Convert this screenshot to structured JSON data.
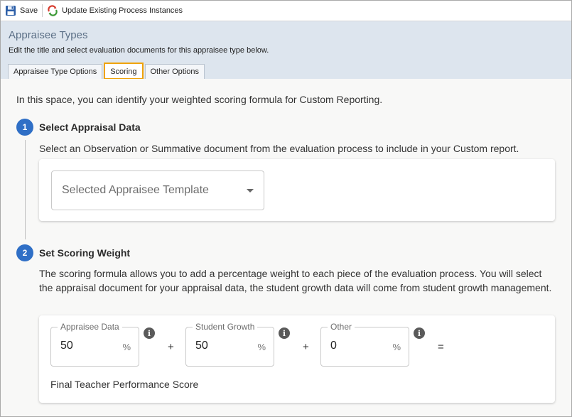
{
  "toolbar": {
    "save_label": "Save",
    "update_label": "Update Existing Process Instances"
  },
  "header": {
    "title": "Appraisee Types",
    "subtitle": "Edit the title and select evaluation documents for this appraisee type below."
  },
  "tabs": [
    {
      "label": "Appraisee Type Options",
      "active": false
    },
    {
      "label": "Scoring",
      "active": true
    },
    {
      "label": "Other Options",
      "active": false
    }
  ],
  "intro": "In this space, you can identify your weighted scoring formula for Custom Reporting.",
  "step1": {
    "number": "1",
    "title": "Select Appraisal Data",
    "description": "Select an Observation or Summative document from the evaluation process to include in your Custom report.",
    "select_placeholder": "Selected Appraisee Template"
  },
  "step2": {
    "number": "2",
    "title": "Set Scoring Weight",
    "description": "The scoring formula allows you to add a percentage weight to each piece of the evaluation process. You will select the appraisal document for your appraisal data, the student growth data will come from student growth management.",
    "fields": [
      {
        "label": "Appraisee Data",
        "value": "50",
        "unit": "%"
      },
      {
        "label": "Student Growth",
        "value": "50",
        "unit": "%"
      },
      {
        "label": "Other",
        "value": "0",
        "unit": "%"
      }
    ],
    "plus": "+",
    "equals": "=",
    "info_glyph": "i",
    "final_label": "Final Teacher Performance Score"
  },
  "colors": {
    "accent": "#2f6fc6",
    "tab_highlight": "#f0a30a",
    "header_bg": "#dde5ee"
  },
  "icons": [
    "save-icon",
    "update-icon",
    "chevron-down-icon",
    "info-icon"
  ]
}
